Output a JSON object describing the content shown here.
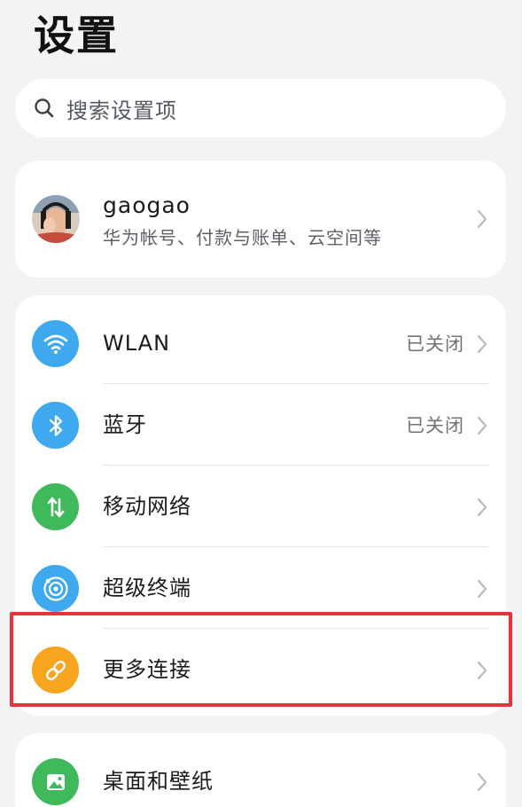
{
  "header": {
    "title": "设置"
  },
  "search": {
    "placeholder": "搜索设置项",
    "icon": "search-icon"
  },
  "account": {
    "name": "gaogao",
    "subtitle": "华为帐号、付款与账单、云空间等"
  },
  "connectivity": {
    "items": [
      {
        "label": "WLAN",
        "status": "已关闭",
        "icon": "wifi-icon",
        "color": "#3fa9ef"
      },
      {
        "label": "蓝牙",
        "status": "已关闭",
        "icon": "bluetooth-icon",
        "color": "#3fa9ef"
      },
      {
        "label": "移动网络",
        "status": "",
        "icon": "mobile-data-icon",
        "color": "#3fb95c"
      },
      {
        "label": "超级终端",
        "status": "",
        "icon": "super-device-icon",
        "color": "#3fa9ef"
      },
      {
        "label": "更多连接",
        "status": "",
        "icon": "link-icon",
        "color": "#f7a51f"
      }
    ]
  },
  "display": {
    "items": [
      {
        "label": "桌面和壁纸",
        "icon": "wallpaper-icon",
        "color": "#3fb95c"
      }
    ]
  },
  "colors": {
    "background": "#f1f3f5",
    "card": "#ffffff",
    "highlight": "#e8333d",
    "secondary_text": "#707377"
  }
}
